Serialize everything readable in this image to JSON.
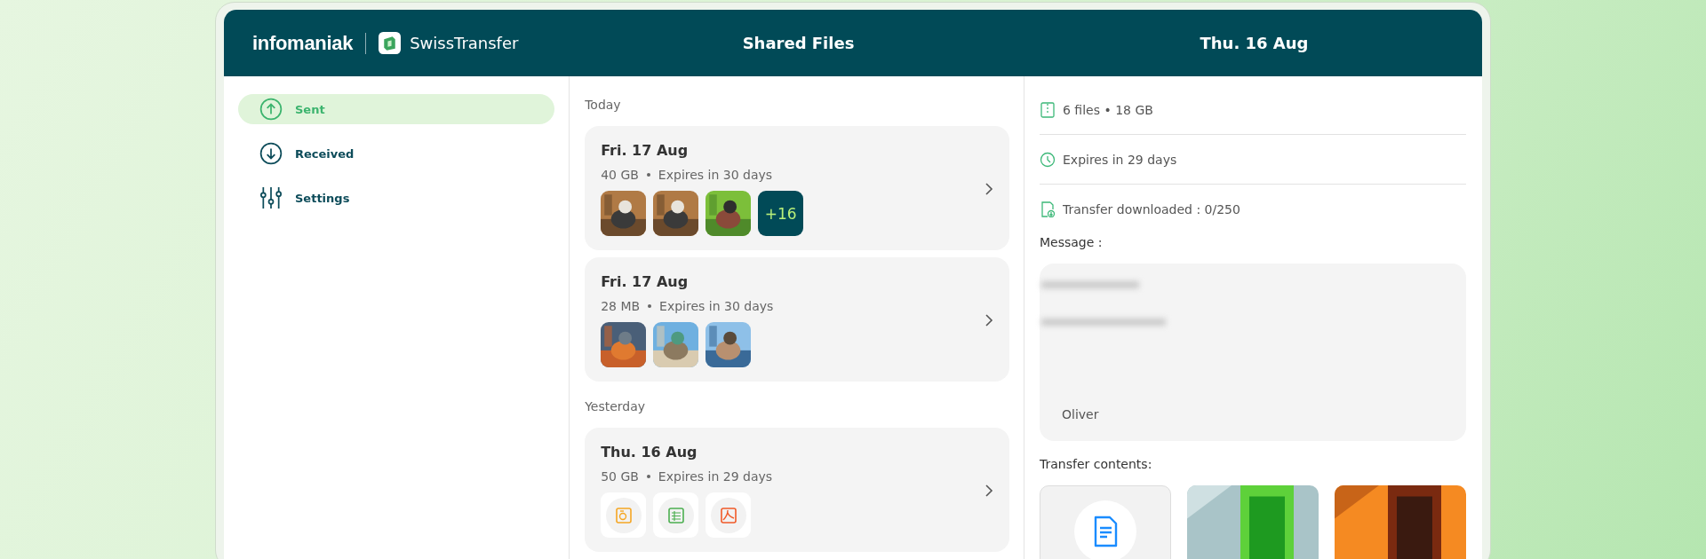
{
  "header": {
    "brand": "infomaniak",
    "app": "SwissTransfer",
    "title": "Shared Files",
    "date": "Thu. 16 Aug"
  },
  "sidebar": {
    "items": [
      {
        "label": "Sent",
        "kind": "sent",
        "selected": true
      },
      {
        "label": "Received",
        "kind": "received",
        "selected": false
      },
      {
        "label": "Settings",
        "kind": "settings",
        "selected": false
      }
    ]
  },
  "transfers": {
    "groups": [
      {
        "heading": "Today",
        "items": [
          {
            "date": "Fri. 17 Aug",
            "size": "40 GB",
            "expiry": "Expires in 30 days",
            "thumbnails": [
              {
                "kind": "picture"
              },
              {
                "kind": "picture"
              },
              {
                "kind": "picture"
              }
            ],
            "more": "+16"
          },
          {
            "date": "Fri. 17 Aug",
            "size": "28 MB",
            "expiry": "Expires in 30 days",
            "thumbnails": [
              {
                "kind": "picture"
              },
              {
                "kind": "picture"
              },
              {
                "kind": "picture"
              }
            ]
          }
        ]
      },
      {
        "heading": "Yesterday",
        "items": [
          {
            "date": "Thu. 16 Aug",
            "size": "50 GB",
            "expiry": "Expires in 29 days",
            "thumbnails": [
              {
                "kind": "archive"
              },
              {
                "kind": "spreadsheet"
              },
              {
                "kind": "pdf"
              }
            ]
          }
        ]
      }
    ]
  },
  "details": {
    "files": "6 files • 18 GB",
    "expiry": "Expires in 29 days",
    "downloads": "Transfer downloaded : 0/250",
    "message_label": "Message :",
    "message_signature": "Oliver",
    "contents_label": "Transfer contents:",
    "contents": [
      {
        "kind": "document"
      },
      {
        "kind": "picture"
      },
      {
        "kind": "picture"
      }
    ]
  }
}
